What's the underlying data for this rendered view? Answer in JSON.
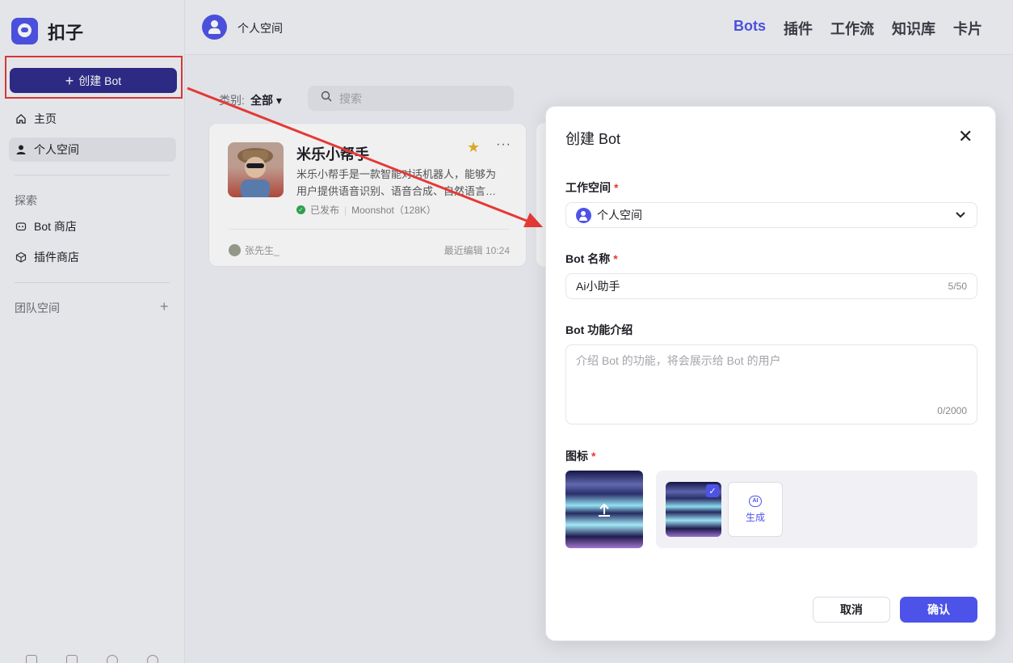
{
  "app": {
    "name": "扣子"
  },
  "sidebar": {
    "create_label": "创建 Bot",
    "items": [
      {
        "label": "主页",
        "icon": "home-icon"
      },
      {
        "label": "个人空间",
        "icon": "user-icon"
      }
    ],
    "explore_label": "探索",
    "explore_items": [
      {
        "label": "Bot 商店",
        "icon": "bot-icon"
      },
      {
        "label": "插件商店",
        "icon": "cube-icon"
      }
    ],
    "team_label": "团队空间"
  },
  "topbar": {
    "workspace_name": "个人空间",
    "tabs": [
      "Bots",
      "插件",
      "工作流",
      "知识库",
      "卡片"
    ],
    "active_tab": "Bots"
  },
  "filter": {
    "label": "类别:",
    "value": "全部"
  },
  "search": {
    "placeholder": "搜索"
  },
  "bot_card": {
    "name": "米乐小帮手",
    "description_line1": "米乐小帮手是一款智能对话机器人，能够为",
    "description_line2": "用户提供语音识别、语音合成、自然语言…",
    "status": "已发布",
    "model": "Moonshot（128K）",
    "author": "张先生_",
    "edited": "最近编辑 10:24"
  },
  "modal": {
    "title": "创建 Bot",
    "workspace_label": "工作空间",
    "workspace_value": "个人空间",
    "name_label": "Bot 名称",
    "name_value": "Ai小助手",
    "name_count": "5/50",
    "desc_label": "Bot 功能介绍",
    "desc_placeholder": "介绍 Bot 的功能，将会展示给 Bot 的用户",
    "desc_count": "0/2000",
    "icon_label": "图标",
    "generate_label": "生成",
    "generate_icon_text": "AI",
    "cancel_label": "取消",
    "confirm_label": "确认"
  },
  "colors": {
    "accent": "#4d53e8",
    "create_button": "#2e2a8a",
    "annotation": "#e53935"
  }
}
